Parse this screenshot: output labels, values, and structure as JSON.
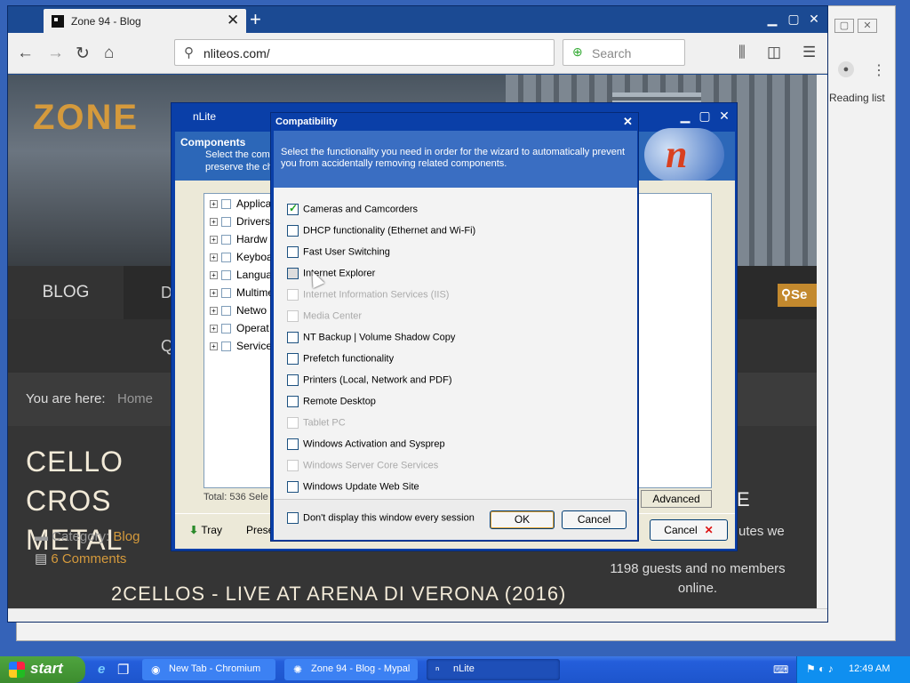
{
  "chromium": {
    "reading_list": "Reading list",
    "avatar_icon": "person-icon",
    "menu_icon": "kebab-menu-icon"
  },
  "browser": {
    "tab_title": "Zone 94 - Blog",
    "tab_close": "✕",
    "new_tab": "+",
    "url": "nliteos.com/",
    "search_placeholder": "Search",
    "back": "←",
    "forward": "→",
    "reload": "↻",
    "home": "⌂",
    "library": "⫼",
    "sidebar": "◫",
    "menu": "☰",
    "minimize": "▁",
    "maximize": "▢",
    "close": "✕"
  },
  "site": {
    "logo": "ZONE",
    "menu_blog": "BLOG",
    "menu_d": "D",
    "submenu_q": "Q",
    "search": "Se",
    "breadcrumb_label": "You are here:",
    "breadcrumb_home": "Home",
    "article_title": "CELLO CROS METAL",
    "category_label": "Category:",
    "category_value": "Blog",
    "comments": "6 Comments",
    "subtitle": "2CELLOS - LIVE AT ARENA DI VERONA (2016)",
    "right_title": "E",
    "right_text": "utes we",
    "guests": "1198 guests and no members online."
  },
  "nlite": {
    "title": "nLite",
    "header_title": "Components",
    "header_text_1": "Select the comp",
    "header_text_2": "preserve the ch",
    "logo_letter": "n",
    "tree": [
      "Applica",
      "Drivers",
      "Hardw",
      "Keyboa",
      "Langua",
      "Multime",
      "Netwo",
      "Operat",
      "Service"
    ],
    "total": "Total: 536 Sele",
    "advanced": "Advanced",
    "tray": "Tray",
    "presets": "Prese",
    "cancel": "Cancel",
    "cancel_icon": "✕",
    "minimize": "▁",
    "maximize": "▢",
    "close": "✕"
  },
  "compat": {
    "title": "Compatibility",
    "close": "✕",
    "description": "Select the functionality you need in order for the wizard to automatically prevent you from accidentally removing related components.",
    "options": [
      {
        "label": "Cameras and Camcorders",
        "state": "checked"
      },
      {
        "label": "DHCP functionality (Ethernet and Wi-Fi)",
        "state": "unchecked"
      },
      {
        "label": "Fast User Switching",
        "state": "unchecked"
      },
      {
        "label": "Internet Explorer",
        "state": "hover"
      },
      {
        "label": "Internet Information Services (IIS)",
        "state": "disabled"
      },
      {
        "label": "Media Center",
        "state": "disabled"
      },
      {
        "label": "NT Backup | Volume Shadow Copy",
        "state": "unchecked"
      },
      {
        "label": "Prefetch functionality",
        "state": "unchecked"
      },
      {
        "label": "Printers (Local, Network and PDF)",
        "state": "unchecked"
      },
      {
        "label": "Remote Desktop",
        "state": "unchecked"
      },
      {
        "label": "Tablet PC",
        "state": "disabled"
      },
      {
        "label": "Windows Activation and Sysprep",
        "state": "unchecked"
      },
      {
        "label": "Windows Server Core Services",
        "state": "disabled"
      },
      {
        "label": "Windows Update Web Site",
        "state": "unchecked"
      }
    ],
    "dont_display": "Don't display this window every session",
    "ok": "OK",
    "cancel": "Cancel"
  },
  "taskbar": {
    "start": "start",
    "ql_ie": "e",
    "ql_2": "❐",
    "items": [
      {
        "label": "New Tab - Chromium",
        "icon": "◉"
      },
      {
        "label": "Zone 94 - Blog - Mypal",
        "icon": "✺"
      },
      {
        "label": "nLite",
        "icon": "ⁿ"
      }
    ],
    "tray_icons": "⚑ ◐ ♪",
    "clock": "12:49 AM"
  }
}
